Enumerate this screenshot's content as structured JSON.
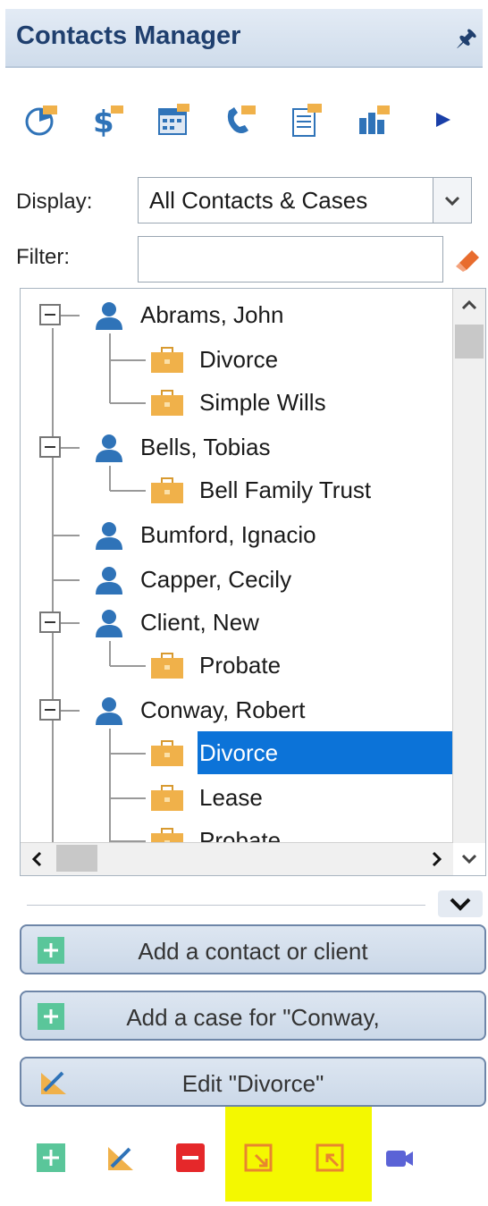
{
  "header": {
    "title": "Contacts Manager",
    "pin_icon": "pin-icon"
  },
  "toolbar": {
    "icons": [
      "pie-chart-icon",
      "billing-icon",
      "calendar-icon",
      "phone-icon",
      "document-icon",
      "chart-icon",
      "play-icon"
    ]
  },
  "display": {
    "label": "Display:",
    "value": "All Contacts & Cases"
  },
  "filter": {
    "label": "Filter:",
    "value": "",
    "clear_icon": "eraser-icon"
  },
  "tree": {
    "contacts": [
      {
        "name": "Abrams, John",
        "cases": [
          "Divorce",
          "Simple Wills"
        ]
      },
      {
        "name": "Bells, Tobias",
        "cases": [
          "Bell Family Trust"
        ]
      },
      {
        "name": "Bumford, Ignacio",
        "cases": []
      },
      {
        "name": "Capper, Cecily",
        "cases": []
      },
      {
        "name": "Client, New",
        "cases": [
          "Probate"
        ]
      },
      {
        "name": "Conway, Robert",
        "cases": [
          "Divorce",
          "Lease",
          "Probate"
        ]
      }
    ],
    "selected": "Divorce"
  },
  "actions": {
    "add_contact": "Add a contact or client",
    "add_case": "Add a case for \"Conway,",
    "edit_case": "Edit \"Divorce\""
  },
  "bottom_icons": [
    "add-icon",
    "edit-icon",
    "remove-icon",
    "export-icon",
    "import-icon",
    "video-icon"
  ],
  "colors": {
    "header_text": "#1f3f6e",
    "person": "#2f73b8",
    "case": "#f0b14a",
    "selection": "#0c73d8",
    "highlight": "#f4f800",
    "add": "#5ac69a",
    "remove": "#e5282a"
  }
}
